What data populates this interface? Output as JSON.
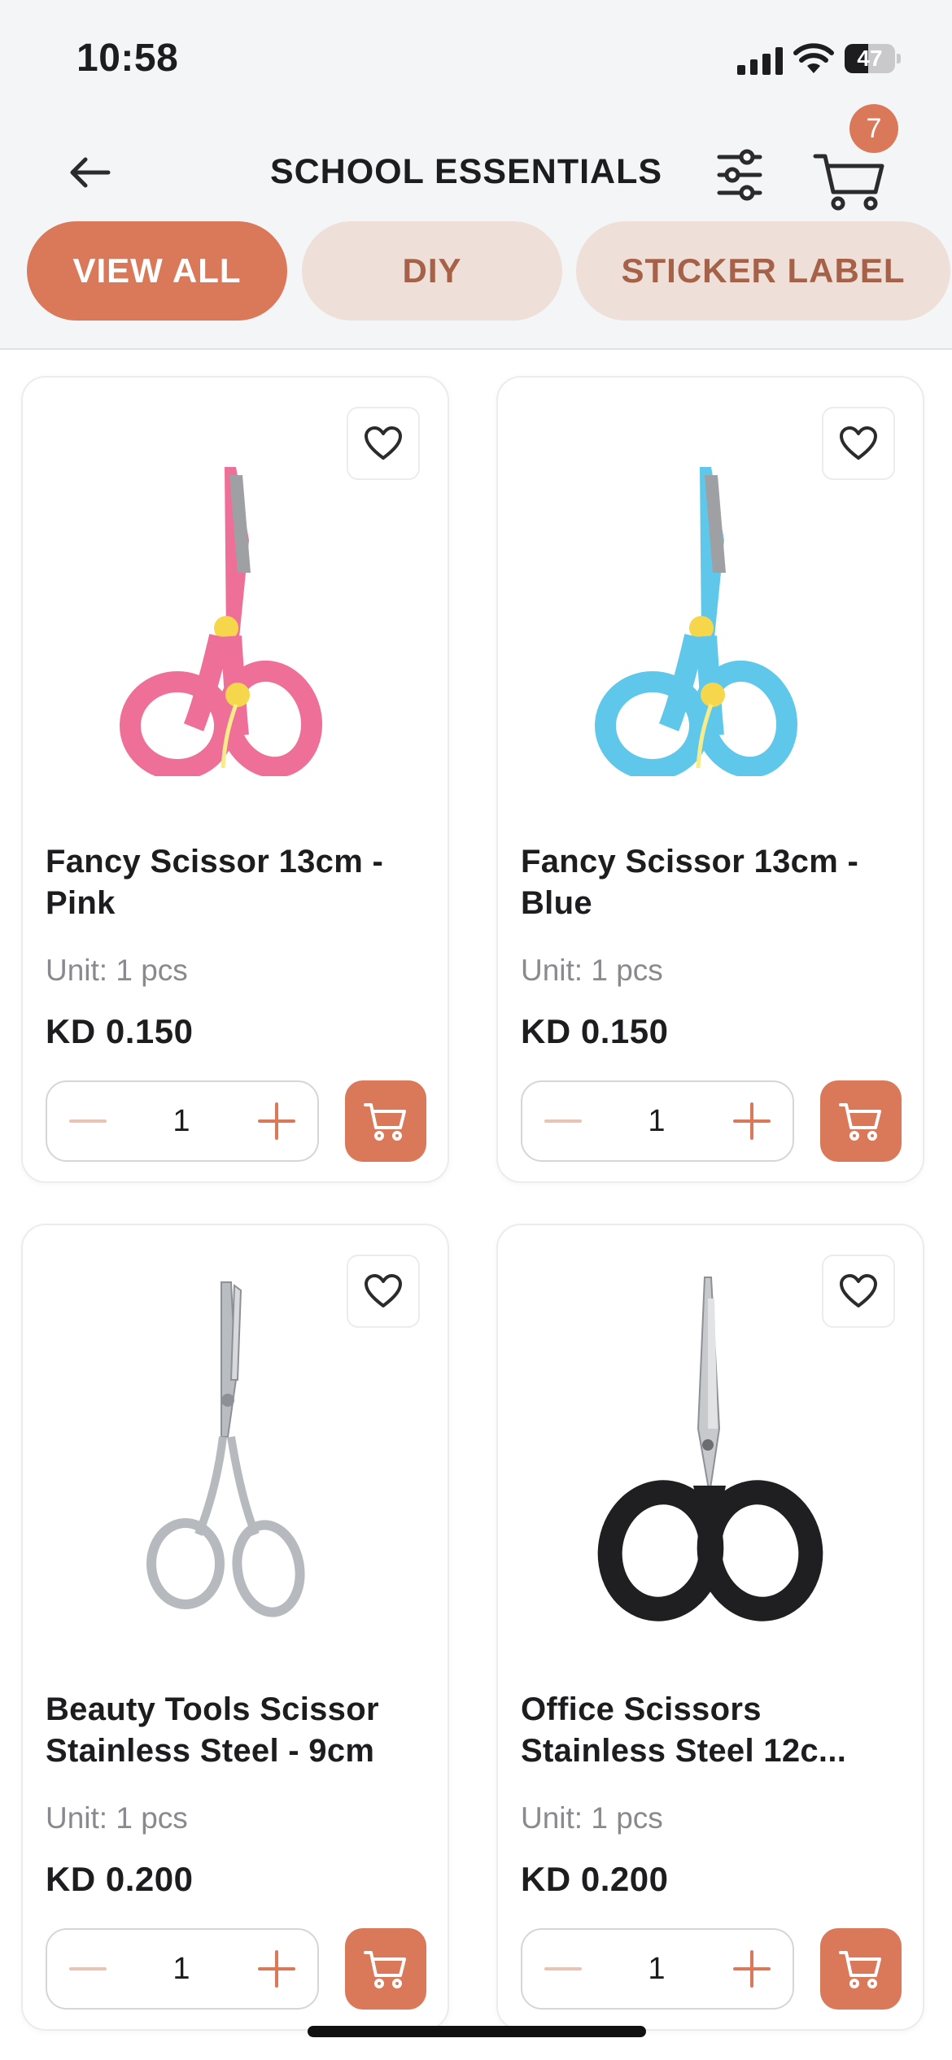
{
  "status_bar": {
    "time": "10:58",
    "battery": "47",
    "battery_fraction": 0.47
  },
  "header": {
    "title": "SCHOOL ESSENTIALS",
    "cart_count": "7",
    "icons": {
      "back": "arrow-left-icon",
      "filter": "sliders-icon",
      "cart": "cart-icon"
    }
  },
  "categories": [
    {
      "label": "VIEW ALL",
      "active": true
    },
    {
      "label": "DIY",
      "active": false
    },
    {
      "label": "STICKER LABEL",
      "active": false
    }
  ],
  "products": [
    {
      "name": "Fancy Scissor 13cm - Pink",
      "unit": "Unit: 1 pcs",
      "price": "KD 0.150",
      "quantity": "1",
      "image": "pink-kids-scissors"
    },
    {
      "name": "Fancy Scissor 13cm - Blue",
      "unit": "Unit: 1 pcs",
      "price": "KD 0.150",
      "quantity": "1",
      "image": "blue-kids-scissors"
    },
    {
      "name": "Beauty Tools Scissor Stainless Steel - 9cm",
      "unit": "Unit: 1 pcs",
      "price": "KD 0.200",
      "quantity": "1",
      "image": "steel-beauty-scissors"
    },
    {
      "name": "Office Scissors Stainless Steel 12c...",
      "unit": "Unit: 1 pcs",
      "price": "KD 0.200",
      "quantity": "1",
      "image": "black-office-scissors"
    }
  ],
  "colors": {
    "accent": "#d9795a",
    "chip_inactive_bg": "#eee0d8",
    "chip_inactive_text": "#a66248",
    "header_bg": "#f4f5f7"
  }
}
